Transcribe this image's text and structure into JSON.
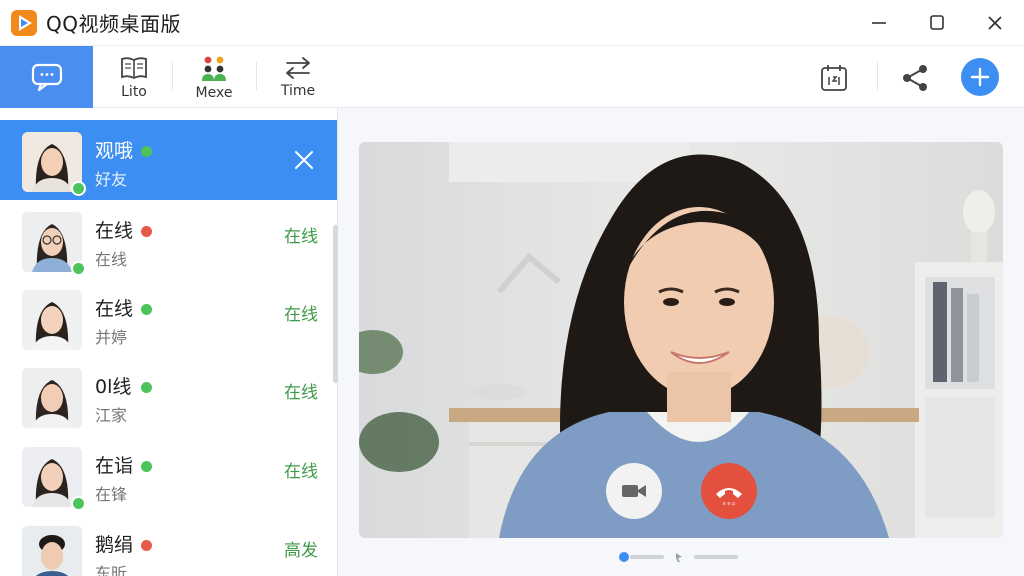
{
  "window": {
    "title": "QQ视频桌面版",
    "brand_color": "#f08a1c"
  },
  "toolbar": {
    "tabs": [
      {
        "label": "Lito",
        "icon": "book-icon"
      },
      {
        "label": "Mexe",
        "icon": "people-icon"
      },
      {
        "label": "Time",
        "icon": "swap-arrows-icon"
      }
    ],
    "accent_color": "#3d8ef2"
  },
  "contacts": [
    {
      "name": "观哦",
      "sub": "好友",
      "status_dot": "#4cc45a",
      "status_text": "",
      "active": true
    },
    {
      "name": "在线",
      "sub": "在线",
      "status_dot": "#e55a4a",
      "status_text": "在线",
      "active": false
    },
    {
      "name": "在线",
      "sub": "并婷",
      "status_dot": "#4cc45a",
      "status_text": "在线",
      "active": false
    },
    {
      "name": "0l线",
      "sub": "江家",
      "status_dot": "#4cc45a",
      "status_text": "在线",
      "active": false
    },
    {
      "name": "在诣",
      "sub": "在锋",
      "status_dot": "#4cc45a",
      "status_text": "在线",
      "active": false
    },
    {
      "name": "鹅绢",
      "sub": "东昕",
      "status_dot": "#e55a4a",
      "status_text": "高发",
      "active": false
    }
  ],
  "call": {
    "end_call_label": "e e p"
  }
}
